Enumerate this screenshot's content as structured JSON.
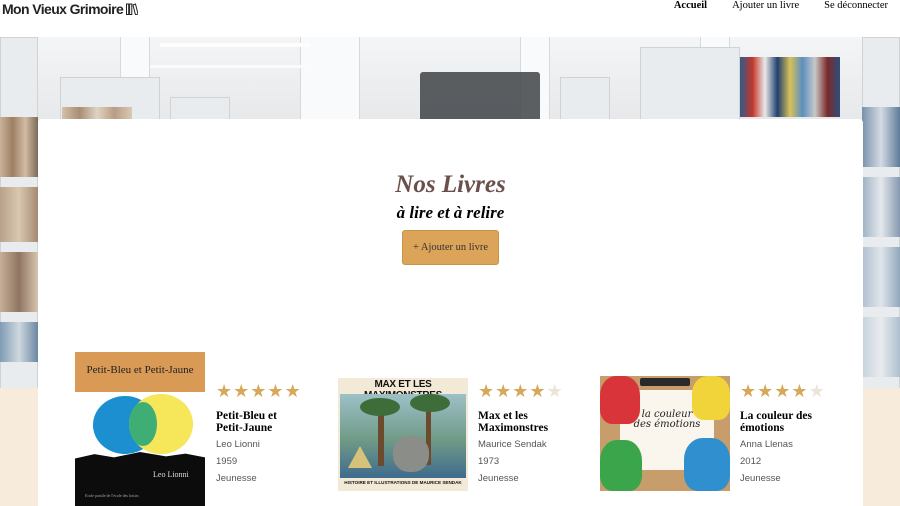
{
  "header": {
    "logo_text": "Mon Vieux Grimoire",
    "nav": [
      {
        "label": "Accueil",
        "active": true
      },
      {
        "label": "Ajouter un livre",
        "active": false
      },
      {
        "label": "Se déconnecter",
        "active": false
      }
    ]
  },
  "main": {
    "title": "Nos Livres",
    "subtitle": "à lire et à relire",
    "add_button_label": "+ Ajouter un livre"
  },
  "books": [
    {
      "title": "Petit-Bleu et Petit-Jaune",
      "author": "Leo Lionni",
      "year": "1959",
      "genre": "Jeunesse",
      "rating": 5,
      "cover_title": "Petit-Bleu et Petit-Jaune",
      "cover_author": "Leo Lionni",
      "cover_footer": "Ecole pastile de l'école des loisirs"
    },
    {
      "title": "Max et les Maximonstres",
      "author": "Maurice Sendak",
      "year": "1973",
      "genre": "Jeunesse",
      "rating": 4,
      "cover_title": "MAX ET LES MAXIMONSTRES",
      "cover_subtitle": "HISTOIRE ET ILLUSTRATIONS DE MAURICE SENDAK"
    },
    {
      "title": "La couleur des émotions",
      "author": "Anna Llenas",
      "year": "2012",
      "genre": "Jeunesse",
      "rating": 4,
      "cover_title": "la couleur des émotions"
    }
  ],
  "colors": {
    "accent": "#dca459",
    "title": "#6b4f4b",
    "star": "#d7a75a",
    "star_empty": "#ece4d6"
  }
}
